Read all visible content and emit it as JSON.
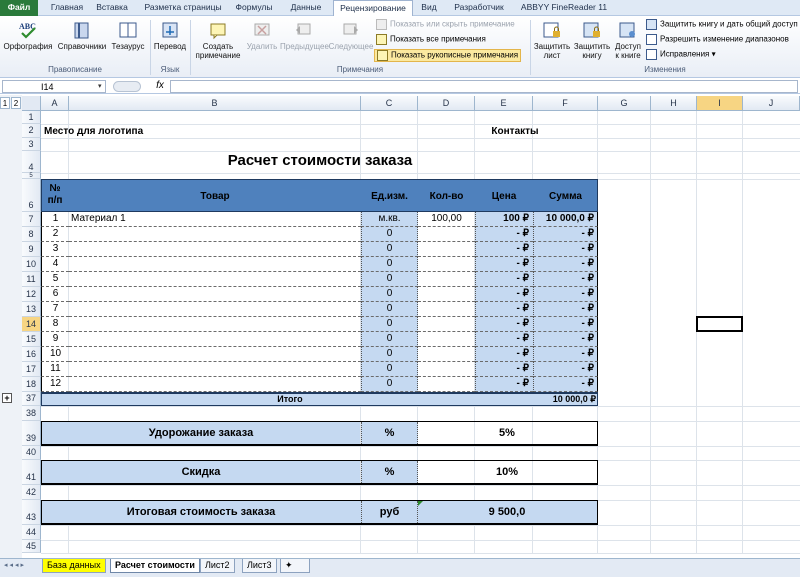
{
  "ribbon_tabs": [
    "Файл",
    "Главная",
    "Вставка",
    "Разметка страницы",
    "Формулы",
    "Данные",
    "Рецензирование",
    "Вид",
    "Разработчик",
    "ABBYY FineReader 11"
  ],
  "ribbon": {
    "spelling": "Орфография",
    "references": "Справочники",
    "thesaurus": "Тезаурус",
    "translate": "Перевод",
    "create_comment_1": "Создать",
    "create_comment_2": "примечание",
    "delete": "Удалить",
    "previous": "Предыдущее",
    "next": "Следующее",
    "show_hide": "Показать или скрыть примечание",
    "show_all": "Показать все примечания",
    "show_ink": "Показать рукописные примечания",
    "protect_sheet_1": "Защитить",
    "protect_sheet_2": "лист",
    "protect_book_1": "Защитить",
    "protect_book_2": "книгу",
    "share_1": "Доступ",
    "share_2": "к книге",
    "protect_share": "Защитить книгу и дать общий доступ",
    "allow_ranges": "Разрешить изменение диапазонов",
    "track_changes": "Исправления ▾",
    "groups": {
      "proofing": "Правописание",
      "language": "Язык",
      "comments": "Примечания",
      "changes": "Изменения"
    }
  },
  "formula_bar": {
    "name_box": "I14",
    "fx": "fx",
    "value": ""
  },
  "columns": [
    "A",
    "B",
    "C",
    "D",
    "E",
    "F",
    "G",
    "H",
    "I",
    "J"
  ],
  "outline_levels": [
    "1",
    "2"
  ],
  "rows": [
    "1",
    "2",
    "3",
    "4",
    "5",
    "6",
    "7",
    "8",
    "9",
    "10",
    "11",
    "12",
    "13",
    "14",
    "15",
    "16",
    "17",
    "18",
    "37",
    "38",
    "39",
    "40",
    "41",
    "42",
    "43",
    "44",
    "45"
  ],
  "sheet": {
    "logo": "Место для логотипа",
    "contacts": "Контакты",
    "title": "Расчет стоимости заказа",
    "headers": {
      "num": "№",
      "num2": "п/п",
      "product": "Товар",
      "unit": "Ед.изм.",
      "qty": "Кол-во",
      "price": "Цена",
      "sum": "Сумма"
    },
    "items": [
      {
        "n": "1",
        "product": "Материал 1",
        "unit": "м.кв.",
        "qty": "100,00",
        "price": "100 ₽",
        "sum": "10 000,0 ₽"
      },
      {
        "n": "2",
        "product": "",
        "unit": "0",
        "qty": "",
        "price": "-   ₽",
        "sum": "-   ₽"
      },
      {
        "n": "3",
        "product": "",
        "unit": "0",
        "qty": "",
        "price": "-   ₽",
        "sum": "-   ₽"
      },
      {
        "n": "4",
        "product": "",
        "unit": "0",
        "qty": "",
        "price": "-   ₽",
        "sum": "-   ₽"
      },
      {
        "n": "5",
        "product": "",
        "unit": "0",
        "qty": "",
        "price": "-   ₽",
        "sum": "-   ₽"
      },
      {
        "n": "6",
        "product": "",
        "unit": "0",
        "qty": "",
        "price": "-   ₽",
        "sum": "-   ₽"
      },
      {
        "n": "7",
        "product": "",
        "unit": "0",
        "qty": "",
        "price": "-   ₽",
        "sum": "-   ₽"
      },
      {
        "n": "8",
        "product": "",
        "unit": "0",
        "qty": "",
        "price": "-   ₽",
        "sum": "-   ₽"
      },
      {
        "n": "9",
        "product": "",
        "unit": "0",
        "qty": "",
        "price": "-   ₽",
        "sum": "-   ₽"
      },
      {
        "n": "10",
        "product": "",
        "unit": "0",
        "qty": "",
        "price": "-   ₽",
        "sum": "-   ₽"
      },
      {
        "n": "11",
        "product": "",
        "unit": "0",
        "qty": "",
        "price": "-   ₽",
        "sum": "-   ₽"
      },
      {
        "n": "12",
        "product": "",
        "unit": "0",
        "qty": "",
        "price": "-   ₽",
        "sum": "-   ₽"
      }
    ],
    "total_label": "Итого",
    "total_value": "10 000,0 ₽",
    "markup_label": "Удорожание заказа",
    "markup_unit": "%",
    "markup_value": "5%",
    "discount_label": "Скидка",
    "discount_unit": "%",
    "discount_value": "10%",
    "final_label": "Итоговая стоимость заказа",
    "final_unit": "руб",
    "final_value": "9 500,0"
  },
  "sheet_tabs": [
    "База данных",
    "Расчет стоимости",
    "Лист2",
    "Лист3"
  ],
  "colors": {
    "header_blue": "#4f81bd",
    "light_blue": "#c5d9f1",
    "file_tab": "#2a7a3b",
    "selected_header": "#f7d583",
    "db_tab": "#ffff00"
  }
}
